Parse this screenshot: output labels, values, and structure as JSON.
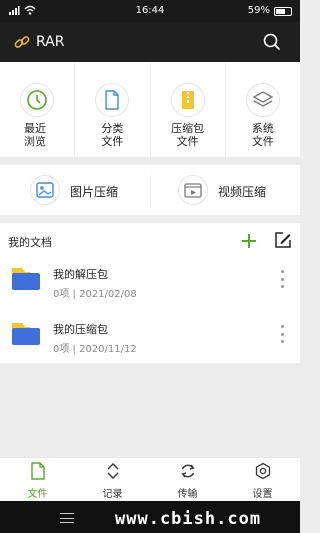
{
  "status_bar": {
    "time": "16:44",
    "battery": "59%"
  },
  "app_bar": {
    "title": "RAR"
  },
  "quick_actions": [
    {
      "label": "最近\n浏览",
      "icon": "clock-icon"
    },
    {
      "label": "分类\n文件",
      "icon": "file-icon"
    },
    {
      "label": "压缩包\n文件",
      "icon": "archive-icon"
    },
    {
      "label": "系统\n文件",
      "icon": "layers-icon"
    }
  ],
  "compress_tools": [
    {
      "label": "图片压缩",
      "icon": "image-icon"
    },
    {
      "label": "视频压缩",
      "icon": "video-icon"
    }
  ],
  "my_docs": {
    "title": "我的文档",
    "items": [
      {
        "name": "我的解压包",
        "meta": "0项 | 2021/02/08"
      },
      {
        "name": "我的压缩包",
        "meta": "0项 | 2020/11/12"
      }
    ]
  },
  "tabs": [
    {
      "label": "文件",
      "active": true
    },
    {
      "label": "记录",
      "active": false
    },
    {
      "label": "传输",
      "active": false
    },
    {
      "label": "设置",
      "active": false
    }
  ],
  "watermark": "www.cbish.com",
  "colors": {
    "accent": "#5aa82a",
    "folder": "#3f6fd9",
    "folder_tab": "#f4c531"
  }
}
